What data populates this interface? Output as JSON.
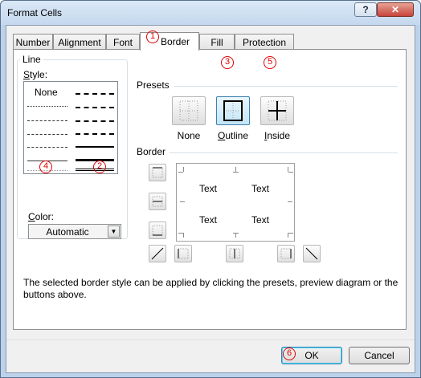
{
  "window": {
    "title": "Format Cells",
    "help_label": "?",
    "close_label": "✕"
  },
  "tabs": [
    {
      "label": "Number",
      "active": false
    },
    {
      "label": "Alignment",
      "active": false
    },
    {
      "label": "Font",
      "active": false
    },
    {
      "label": "Border",
      "active": true
    },
    {
      "label": "Fill",
      "active": false
    },
    {
      "label": "Protection",
      "active": false
    }
  ],
  "line": {
    "group_label": "Line",
    "style_label": "Style:",
    "style_none": "None",
    "color_label": "Color:",
    "color_value": "Automatic"
  },
  "presets": {
    "group_label": "Presets",
    "none_label": "None",
    "outline_label": "Outline",
    "inside_label": "Inside"
  },
  "border": {
    "group_label": "Border",
    "preview_texts": [
      "Text",
      "Text",
      "Text",
      "Text"
    ]
  },
  "description": "The selected border style can be applied by clicking the presets, preview diagram or the buttons above.",
  "buttons": {
    "ok_label": "OK",
    "cancel_label": "Cancel"
  },
  "annotations": {
    "m1": "1",
    "m2": "2",
    "m3": "3",
    "m4": "4",
    "m5": "5",
    "m6": "6"
  },
  "colors": {
    "annotation": "#e00000",
    "title_bar": "#c4d8ee",
    "active_button_border": "#3c7fb1"
  }
}
